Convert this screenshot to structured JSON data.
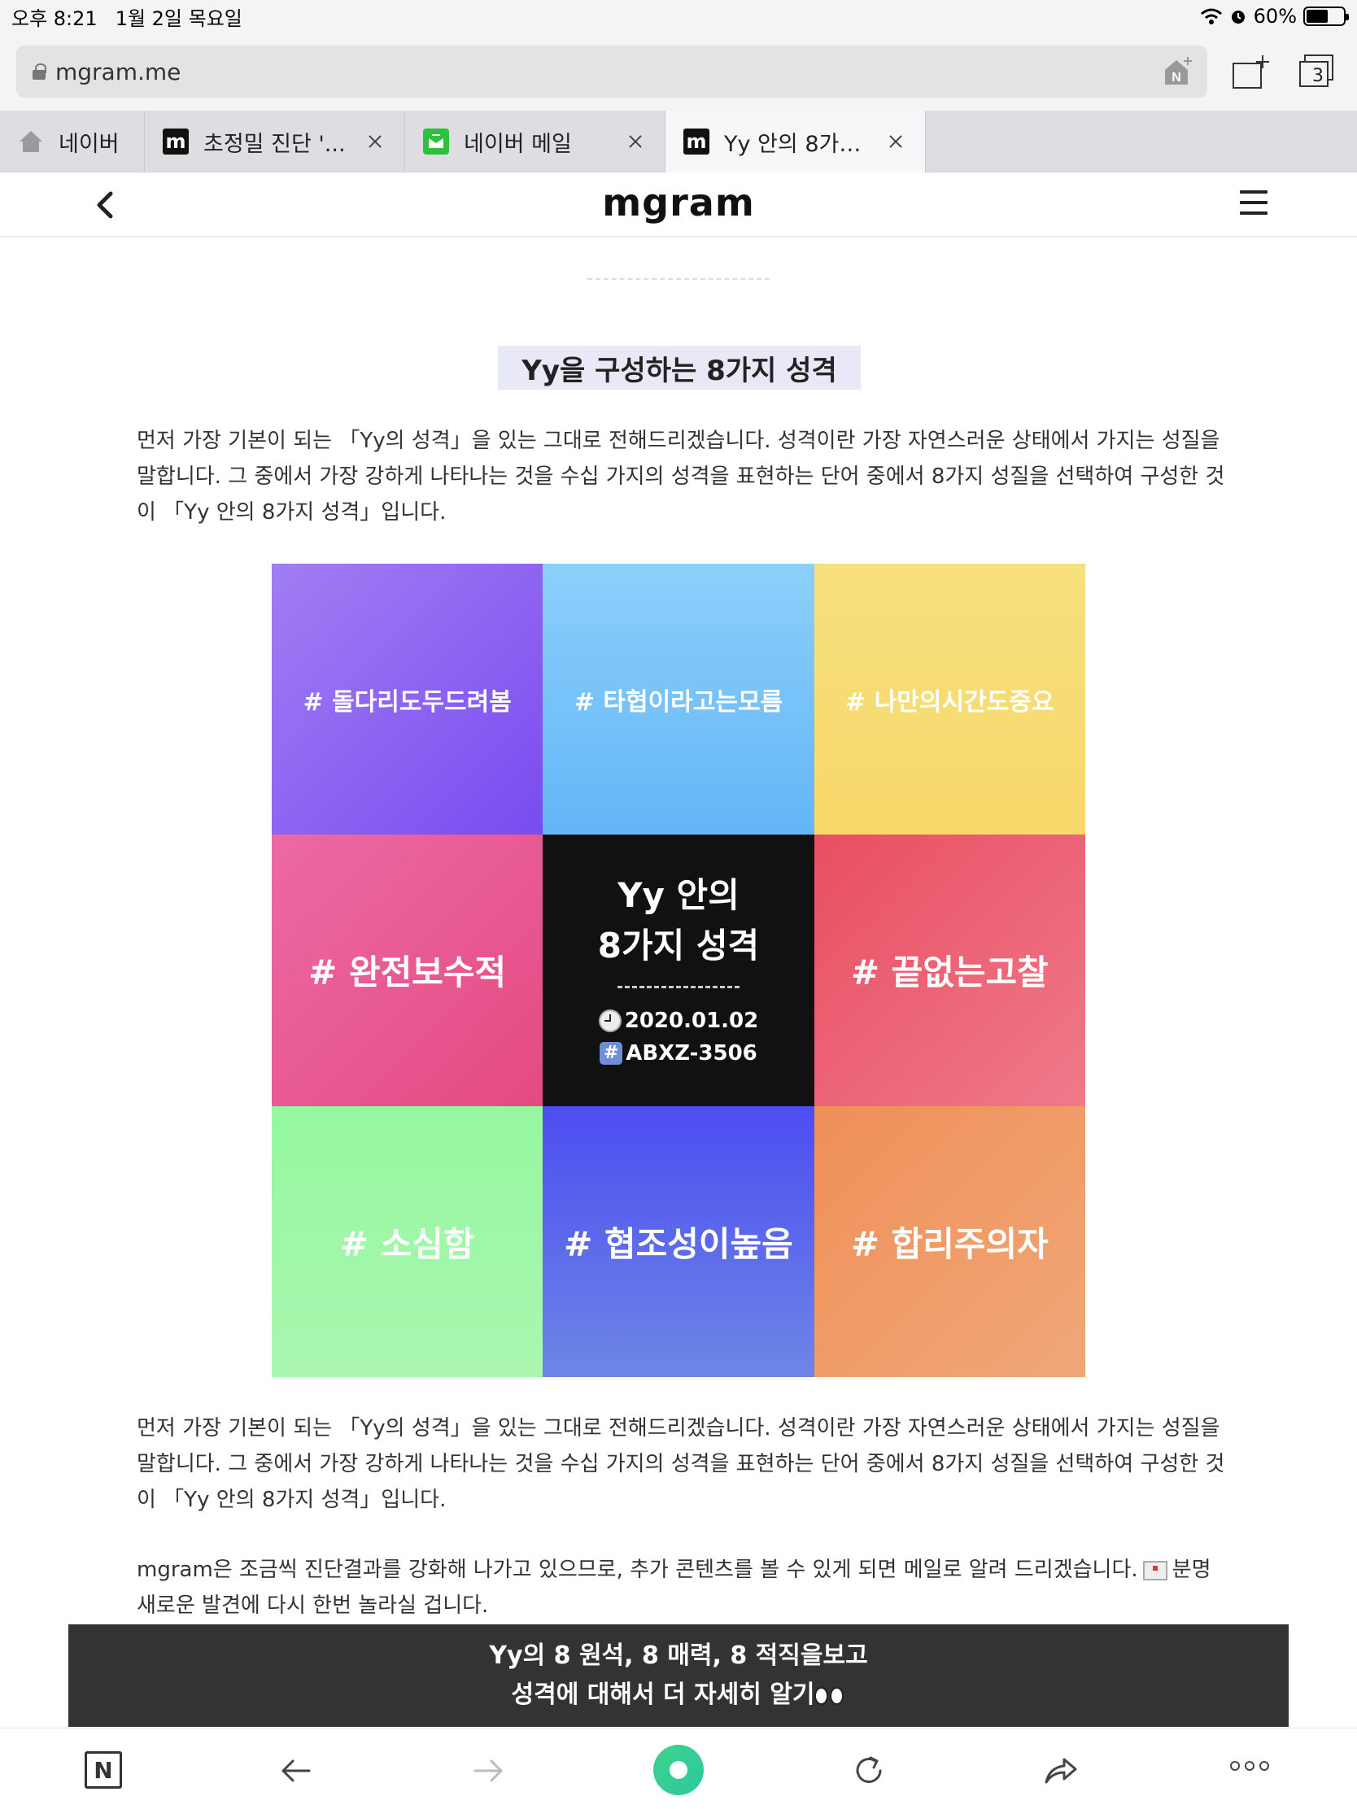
{
  "status_bar": {
    "time": "오후 8:21",
    "date": "1월 2일 목요일",
    "battery": "60%",
    "battery_level": 0.6
  },
  "browser": {
    "url": "mgram.me",
    "tab_count": "3",
    "tabs": [
      {
        "label": "네이버",
        "icon": "home-icon",
        "closable": false
      },
      {
        "label": "초정밀 진단 '...",
        "icon": "mgram-icon",
        "closable": true
      },
      {
        "label": "네이버 메일",
        "icon": "mail-icon",
        "closable": true
      },
      {
        "label": "Yy 안의 8가…",
        "icon": "mgram-icon",
        "closable": true,
        "active": true
      }
    ]
  },
  "site": {
    "logo": "mgram"
  },
  "content": {
    "section_title": "Yy을 구성하는 8가지 성격",
    "intro_text": "먼저 가장 기본이 되는 「Yy의 성격」을 있는 그대로 전해드리겠습니다. 성격이란 가장 자연스러운 상태에서 가지는 성질을 말합니다. 그 중에서 가장 강하게 나타나는 것을 수십 가지의 성격을 표현하는 단어 중에서 8가지 성질을 선택하여 구성한 것이 「Yy 안의 8가지 성격」입니다.",
    "repeat_text": "먼저 가장 기본이 되는 「Yy의 성격」을 있는 그대로 전해드리겠습니다. 성격이란 가장 자연스러운 상태에서 가지는 성질을 말합니다. 그 중에서 가장 강하게 나타나는 것을 수십 가지의 성격을 표현하는 단어 중에서 8가지 성질을 선택하여 구성한 것이 「Yy 안의 8가지 성격」입니다.",
    "notice_text_1": "mgram은 조금씩 진단결과를 강화해 나가고 있으므로, 추가 콘텐츠를 볼 수 있게 되면 메일로 알려 드리겠습니다.",
    "notice_text_2": "분명 새로운 발견에 다시 한번 놀라실 겁니다."
  },
  "grid": {
    "traits": [
      "# 돌다리도두드려봄",
      "# 타협이라고는모름",
      "# 나만의시간도중요",
      "# 완전보수적",
      "# 끝없는고찰",
      "# 소심함",
      "# 협조성이높음",
      "# 합리주의자"
    ],
    "center_title_1": "Yy 안의",
    "center_title_2": "8가지 성격",
    "center_date": "2020.01.02",
    "center_id": "ABXZ-3506"
  },
  "cta": {
    "line1": "Yy의 8 원석, 8 매력, 8 적직을보고",
    "line2": "성격에 대해서 더 자세히 알기"
  },
  "toolbar": {
    "home_label": "N"
  },
  "colors": {
    "section_title_bg": "#e9e8f7",
    "cta_bg": "#333333",
    "green_accent": "#3ed38a"
  }
}
